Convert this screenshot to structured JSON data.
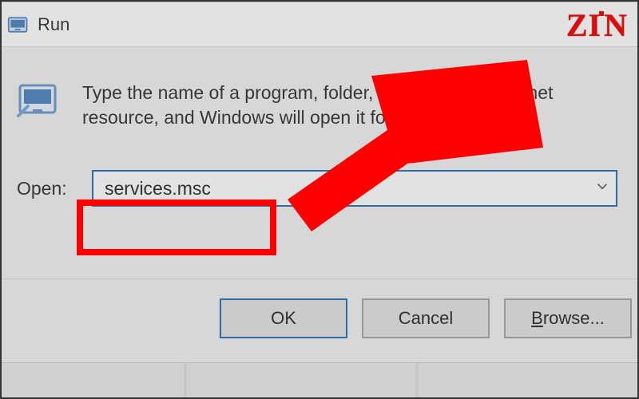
{
  "window": {
    "title": "Run",
    "description": "Type the name of a program, folder, document, or Internet resource, and Windows will open it for you.",
    "open_label": "Open:",
    "input_value": "services.msc",
    "buttons": {
      "ok": "OK",
      "cancel": "Cancel",
      "browse": "Browse..."
    }
  },
  "watermark": "ZIN",
  "colors": {
    "accent": "#0a63b0",
    "highlight": "#ff0000"
  }
}
